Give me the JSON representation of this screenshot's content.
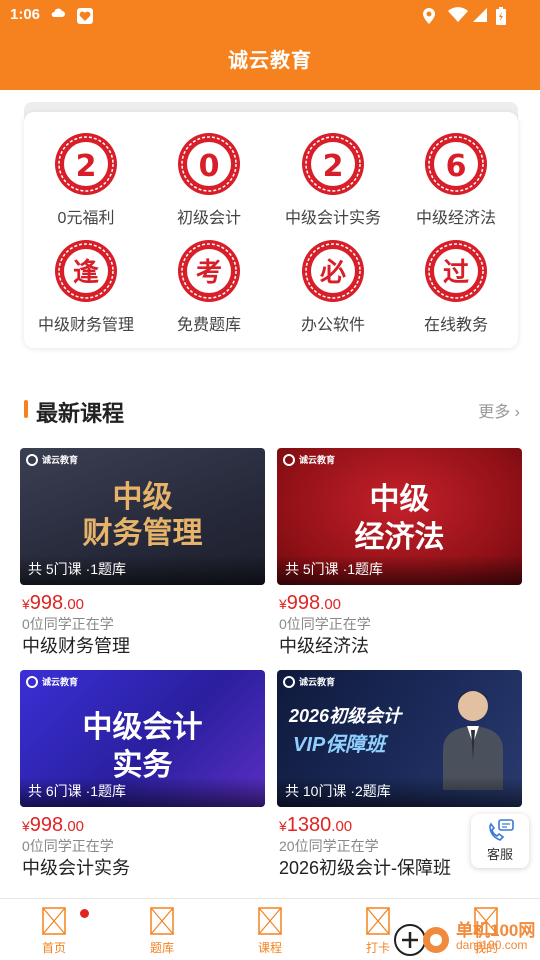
{
  "status_bar": {
    "time": "1:06"
  },
  "header": {
    "title": "诚云教育"
  },
  "grid": [
    {
      "glyph": "2",
      "label": "0元福利"
    },
    {
      "glyph": "0",
      "label": "初级会计"
    },
    {
      "glyph": "2",
      "label": "中级会计实务"
    },
    {
      "glyph": "6",
      "label": "中级经济法"
    },
    {
      "glyph": "逢",
      "label": "中级财务管理"
    },
    {
      "glyph": "考",
      "label": "免费题库"
    },
    {
      "glyph": "必",
      "label": "办公软件"
    },
    {
      "glyph": "过",
      "label": "在线教务"
    }
  ],
  "section": {
    "title": "最新课程",
    "more": "更多 ›"
  },
  "courses": [
    {
      "thumb_line1": "中级",
      "thumb_line2": "财务管理",
      "thumb_logo": "诚云教育",
      "caption": "共 5门课 ·1题库",
      "currency": "¥",
      "price_int": "998",
      "price_dec": ".00",
      "learners": "0位同学正在学",
      "name": "中级财务管理"
    },
    {
      "thumb_line1": "中级",
      "thumb_line2": "经济法",
      "thumb_logo": "诚云教育",
      "caption": "共 5门课 ·1题库",
      "currency": "¥",
      "price_int": "998",
      "price_dec": ".00",
      "learners": "0位同学正在学",
      "name": "中级经济法"
    },
    {
      "thumb_line1": "中级会计",
      "thumb_line2": "实务",
      "thumb_logo": "诚云教育",
      "caption": "共 6门课 ·1题库",
      "currency": "¥",
      "price_int": "998",
      "price_dec": ".00",
      "learners": "0位同学正在学",
      "name": "中级会计实务"
    },
    {
      "thumb_line1": "2026初级会计",
      "thumb_line2": "VIP保障班",
      "thumb_logo": "诚云教育",
      "caption": "共 10门课 ·2题库",
      "currency": "¥",
      "price_int": "1380",
      "price_dec": ".00",
      "learners": "20位同学正在学",
      "name": "2026初级会计-保障班"
    }
  ],
  "service": {
    "label": "客服"
  },
  "bottom_nav": [
    {
      "label": "首页",
      "badge": true
    },
    {
      "label": "题库"
    },
    {
      "label": "课程"
    },
    {
      "label": "打卡"
    },
    {
      "label": "我的"
    }
  ],
  "watermark": {
    "line1": "单机100网",
    "line2": "danji100.com"
  },
  "colors": {
    "brand": "#f5821f",
    "price": "#e02424",
    "seal": "#d81e28"
  }
}
